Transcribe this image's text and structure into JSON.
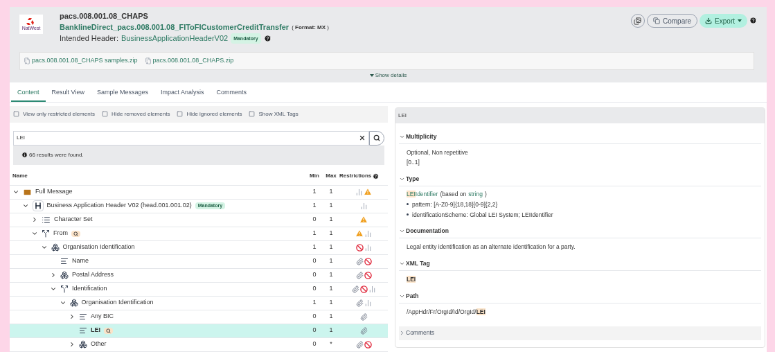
{
  "header": {
    "logo_text": "NatWest",
    "title": "pacs.008.001.08_CHAPS",
    "message_link": "BanklineDirect_pacs.008.001.08_FIToFICustomerCreditTransfer",
    "format": "( **Format: MX** )",
    "intended_label": "Intended Header:",
    "intended_link": "BusinessApplicationHeaderV02",
    "intended_badge": "Mandatory",
    "files": [
      "pacs.008.001.08_CHAPS samples.zip",
      "pacs.008.001.08_CHAPS.zip"
    ],
    "show_details": "Show details",
    "buttons": [
      {
        "kind": "icon"
      },
      {
        "kind": "compare",
        "label": "Compare"
      },
      {
        "kind": "export",
        "label": "Export"
      }
    ]
  },
  "tabs": [
    {
      "label": "Content",
      "selected": true
    },
    {
      "label": "Result View",
      "selected": false
    },
    {
      "label": "Sample Messages",
      "selected": false
    },
    {
      "label": "Impact Analysis",
      "selected": false
    },
    {
      "label": "Comments",
      "selected": false
    }
  ],
  "filters": [
    {
      "label": "View only restricted elements",
      "checked": false
    },
    {
      "label": "Hide removed elements",
      "checked": false
    },
    {
      "label": "Hide ignored elements",
      "checked": false
    },
    {
      "label": "Show XML Tags",
      "checked": false
    }
  ],
  "search": {
    "value": "LEI",
    "result": "66 results were found."
  },
  "table": {
    "columns": [
      "Name",
      "Min",
      "Max",
      "Restrictions"
    ],
    "rows": [
      {
        "name": "Full Message",
        "kind": "envelope",
        "expanded": true,
        "min": "1",
        "max": "1",
        "restrictions": [
          {
            "kind": "chart"
          },
          {
            "kind": "warning"
          }
        ],
        "selected": false,
        "search_hit": false,
        "children": [
          {
            "name": "Business Application Header V02 (head.001.001.02)",
            "badge": "Mandatory",
            "kind": "header",
            "expanded": true,
            "min": "1",
            "max": "1",
            "restrictions": [
              {
                "kind": "chart"
              }
            ],
            "selected": false,
            "search_hit": false,
            "children": [
              {
                "name": "Character Set",
                "kind": "list",
                "expanded": false,
                "min": "0",
                "max": "1",
                "restrictions": [
                  {
                    "kind": "warning"
                  }
                ],
                "selected": false,
                "search_hit": false
              },
              {
                "name": "From",
                "kind": "choice",
                "expanded": true,
                "min": "1",
                "max": "1",
                "restrictions": [
                  {
                    "kind": "warning"
                  },
                  {
                    "kind": "chart"
                  }
                ],
                "selected": false,
                "search_hit": true,
                "children": [
                  {
                    "name": "Organisation Identification",
                    "kind": "component",
                    "expanded": true,
                    "min": "1",
                    "max": "1",
                    "restrictions": [
                      {
                        "kind": "forbidden"
                      },
                      {
                        "kind": "chart"
                      }
                    ],
                    "selected": false,
                    "search_hit": false,
                    "children": [
                      {
                        "name": "Name",
                        "kind": "field",
                        "min": "0",
                        "max": "1",
                        "restrictions": [
                          {
                            "kind": "link"
                          },
                          {
                            "kind": "forbidden"
                          }
                        ],
                        "selected": false,
                        "search_hit": false
                      },
                      {
                        "name": "Postal Address",
                        "kind": "component",
                        "expanded": false,
                        "min": "0",
                        "max": "1",
                        "restrictions": [
                          {
                            "kind": "link"
                          },
                          {
                            "kind": "forbidden"
                          }
                        ],
                        "selected": false,
                        "search_hit": false
                      },
                      {
                        "name": "Identification",
                        "kind": "choice",
                        "expanded": true,
                        "min": "0",
                        "max": "1",
                        "restrictions": [
                          {
                            "kind": "link"
                          },
                          {
                            "kind": "forbidden"
                          },
                          {
                            "kind": "chart"
                          }
                        ],
                        "selected": false,
                        "search_hit": false,
                        "children": [
                          {
                            "name": "Organisation Identification",
                            "kind": "component",
                            "expanded": true,
                            "min": "1",
                            "max": "1",
                            "restrictions": [
                              {
                                "kind": "link"
                              },
                              {
                                "kind": "chart"
                              }
                            ],
                            "selected": false,
                            "search_hit": false,
                            "children": [
                              {
                                "name": "Any BIC",
                                "kind": "field",
                                "expanded": false,
                                "min": "0",
                                "max": "1",
                                "restrictions": [
                                  {
                                    "kind": "link"
                                  }
                                ],
                                "selected": false,
                                "search_hit": false
                              },
                              {
                                "name": "LEI",
                                "kind": "field",
                                "min": "0",
                                "max": "1",
                                "restrictions": [
                                  {
                                    "kind": "link"
                                  }
                                ],
                                "selected": true,
                                "search_hit": true
                              },
                              {
                                "name": "Other",
                                "kind": "component",
                                "expanded": false,
                                "min": "0",
                                "max": "*",
                                "restrictions": [
                                  {
                                    "kind": "link"
                                  },
                                  {
                                    "kind": "forbidden"
                                  }
                                ],
                                "selected": false,
                                "search_hit": false
                              }
                            ]
                          }
                        ]
                      }
                    ]
                  }
                ]
              }
            ]
          }
        ]
      }
    ]
  },
  "detail": {
    "title": "LEI",
    "sections": [
      {
        "title": "Multiplicity",
        "expanded": true,
        "kind": "lines",
        "lines": [
          "Optional, Non repetitive",
          "[0..1]"
        ]
      },
      {
        "title": "Type",
        "expanded": true,
        "kind": "type",
        "type_parts": [
          {
            "text": "LEI",
            "highlight": true
          },
          {
            "text": "Identifier",
            "highlight": false
          }
        ],
        "based_label": "(based on",
        "based_type": "string",
        "based_close": ")",
        "bullets": [
          "pattern: [A-Z0-9]{18,18}[0-9]{2,2}",
          "identificationScheme: Global LEI System; LEIIdentifier"
        ]
      },
      {
        "title": "Documentation",
        "expanded": true,
        "kind": "lines",
        "lines": [
          "Legal entity identification as an alternate identification for a party."
        ]
      },
      {
        "title": "XML Tag",
        "expanded": true,
        "kind": "parts",
        "parts": [
          {
            "text": "LEI",
            "highlight": true
          }
        ]
      },
      {
        "title": "Path",
        "expanded": true,
        "kind": "parts",
        "parts": [
          {
            "text": "/AppHdr/Fr/OrgId/Id/OrgId/",
            "highlight": false
          },
          {
            "text": "LEI",
            "highlight": true
          }
        ]
      },
      {
        "title": "Comments",
        "expanded": false
      }
    ]
  }
}
